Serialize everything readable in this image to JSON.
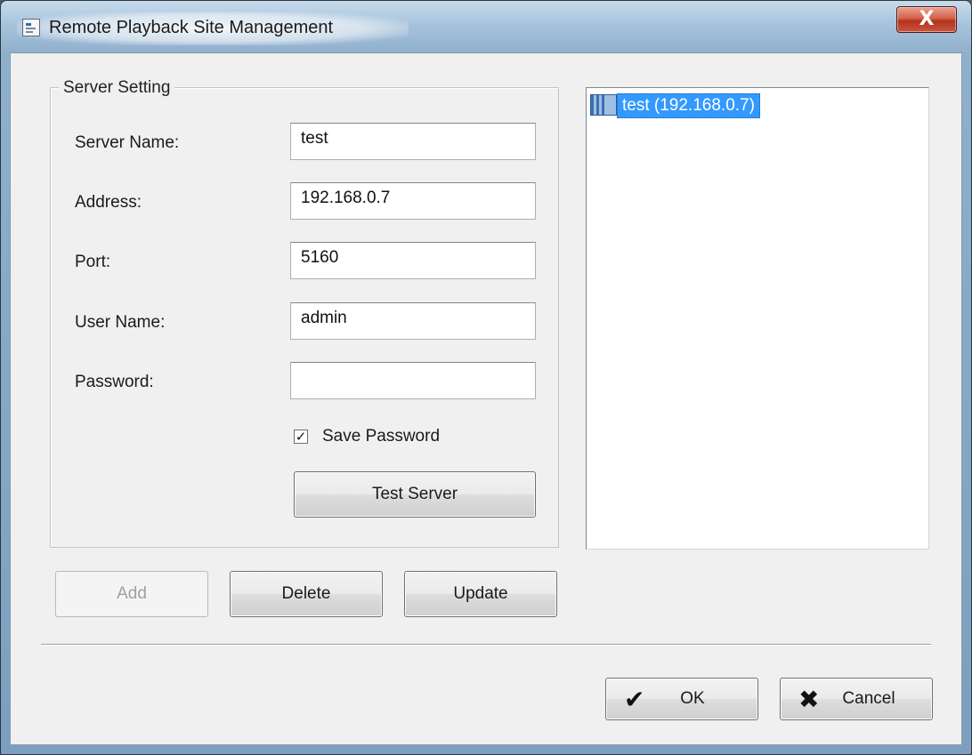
{
  "window": {
    "title": "Remote Playback Site Management",
    "close_glyph": "X"
  },
  "server_setting": {
    "legend": "Server Setting",
    "fields": {
      "server_name": {
        "label": "Server Name:",
        "value": "test"
      },
      "address": {
        "label": "Address:",
        "value": "192.168.0.7"
      },
      "port": {
        "label": "Port:",
        "value": "5160"
      },
      "user_name": {
        "label": "User Name:",
        "value": "admin"
      },
      "password": {
        "label": "Password:",
        "value": ""
      }
    },
    "save_password": {
      "label": "Save Password",
      "checked": true
    },
    "test_server_label": "Test Server"
  },
  "actions": {
    "add_label": "Add",
    "delete_label": "Delete",
    "update_label": "Update"
  },
  "site_tree": {
    "items": [
      {
        "label": "test (192.168.0.7)",
        "selected": true,
        "icon": "network-site-icon"
      }
    ]
  },
  "footer": {
    "ok_label": "OK",
    "cancel_label": "Cancel",
    "ok_icon": "checkmark-icon",
    "cancel_icon": "x-mark-icon"
  },
  "colors": {
    "selection": "#3399ff",
    "close_button": "#c9563e"
  }
}
